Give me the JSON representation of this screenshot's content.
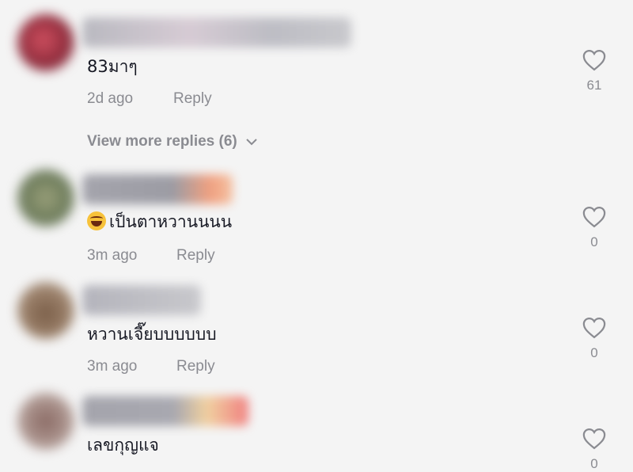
{
  "comments": [
    {
      "text": "83มาๆ",
      "time": "2d ago",
      "reply_label": "Reply",
      "likes": "61",
      "view_more": "View more replies (6)"
    },
    {
      "text": "เป็นตาหวานนนน",
      "emoji": "laughing-emoji",
      "time": "3m ago",
      "reply_label": "Reply",
      "likes": "0"
    },
    {
      "text": "หวานเจี๊ยบบบบบบ",
      "time": "3m ago",
      "reply_label": "Reply",
      "likes": "0"
    },
    {
      "text": "เลขกุญแจ",
      "time": "",
      "reply_label": "",
      "likes": "0"
    }
  ],
  "colors": {
    "background": "#f4f4f4",
    "text": "#161823",
    "muted": "#8a8b91"
  },
  "icons": [
    "heart-outline-icon",
    "chevron-down-icon",
    "laughing-emoji"
  ]
}
